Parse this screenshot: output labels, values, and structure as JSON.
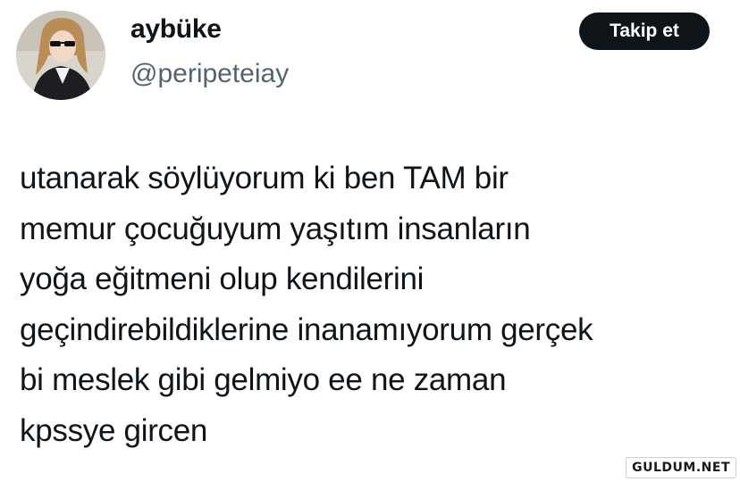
{
  "author": {
    "display_name": "aybüke",
    "handle": "@peripeteiay"
  },
  "follow_button": {
    "label": "Takip et"
  },
  "tweet": {
    "lines": [
      "utanarak söylüyorum ki ben TAM bir",
      "memur çocuğuyum yaşıtım insanların",
      "yoğa eğitmeni olup kendilerini",
      "geçindirebildiklerine inanamıyorum gerçek",
      "bi meslek gibi gelmiyo ee ne zaman",
      "kpssye gircen"
    ]
  },
  "watermark": {
    "text": "GULDUM.NET"
  },
  "colors": {
    "primary_text": "#0f1419",
    "secondary_text": "#536471",
    "button_bg": "#0f1419",
    "button_text": "#ffffff",
    "background": "#ffffff"
  },
  "icons": {
    "avatar": "profile-photo"
  }
}
